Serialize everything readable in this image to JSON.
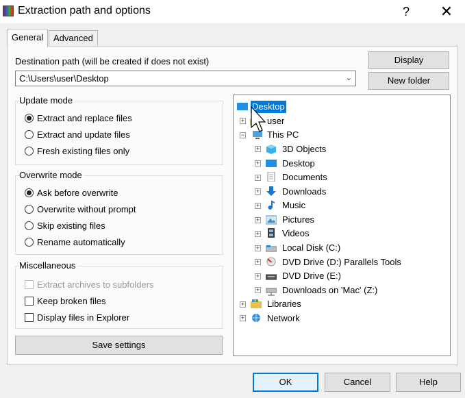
{
  "window": {
    "title": "Extraction path and options",
    "help_symbol": "?",
    "close_symbol": "✕"
  },
  "tabs": [
    {
      "label": "General",
      "active": true
    },
    {
      "label": "Advanced",
      "active": false
    }
  ],
  "destination": {
    "label": "Destination path (will be created if does not exist)",
    "value": "C:\\Users\\user\\Desktop"
  },
  "buttons": {
    "display": "Display",
    "new_folder": "New folder",
    "save_settings": "Save settings",
    "ok": "OK",
    "cancel": "Cancel",
    "help": "Help"
  },
  "update_mode": {
    "title": "Update mode",
    "options": [
      {
        "label": "Extract and replace files",
        "selected": true
      },
      {
        "label": "Extract and update files",
        "selected": false
      },
      {
        "label": "Fresh existing files only",
        "selected": false
      }
    ]
  },
  "overwrite_mode": {
    "title": "Overwrite mode",
    "options": [
      {
        "label": "Ask before overwrite",
        "selected": true
      },
      {
        "label": "Overwrite without prompt",
        "selected": false
      },
      {
        "label": "Skip existing files",
        "selected": false
      },
      {
        "label": "Rename automatically",
        "selected": false
      }
    ]
  },
  "misc": {
    "title": "Miscellaneous",
    "options": [
      {
        "label": "Extract archives to subfolders",
        "checked": false,
        "disabled": true
      },
      {
        "label": "Keep broken files",
        "checked": false,
        "disabled": false
      },
      {
        "label": "Display files in Explorer",
        "checked": false,
        "disabled": false
      }
    ]
  },
  "tree": {
    "items": [
      {
        "label": "Desktop",
        "icon": "desktop-icon",
        "selected": true
      },
      {
        "label": "user",
        "icon": "user-folder-icon"
      },
      {
        "label": "This PC",
        "icon": "computer-icon"
      },
      {
        "label": "3D Objects",
        "icon": "cube-icon"
      },
      {
        "label": "Desktop",
        "icon": "desktop-icon"
      },
      {
        "label": "Documents",
        "icon": "document-icon"
      },
      {
        "label": "Downloads",
        "icon": "download-icon"
      },
      {
        "label": "Music",
        "icon": "music-icon"
      },
      {
        "label": "Pictures",
        "icon": "pictures-icon"
      },
      {
        "label": "Videos",
        "icon": "video-icon"
      },
      {
        "label": "Local Disk (C:)",
        "icon": "disk-icon"
      },
      {
        "label": "DVD Drive (D:) Parallels Tools",
        "icon": "dvd-icon"
      },
      {
        "label": "DVD Drive (E:)",
        "icon": "dvd-drive-icon"
      },
      {
        "label": "Downloads on 'Mac' (Z:)",
        "icon": "network-drive-icon"
      },
      {
        "label": "Libraries",
        "icon": "libraries-icon"
      },
      {
        "label": "Network",
        "icon": "network-icon"
      }
    ]
  },
  "colors": {
    "selection": "#0078d7",
    "window_bg": "#f0f0f0"
  }
}
